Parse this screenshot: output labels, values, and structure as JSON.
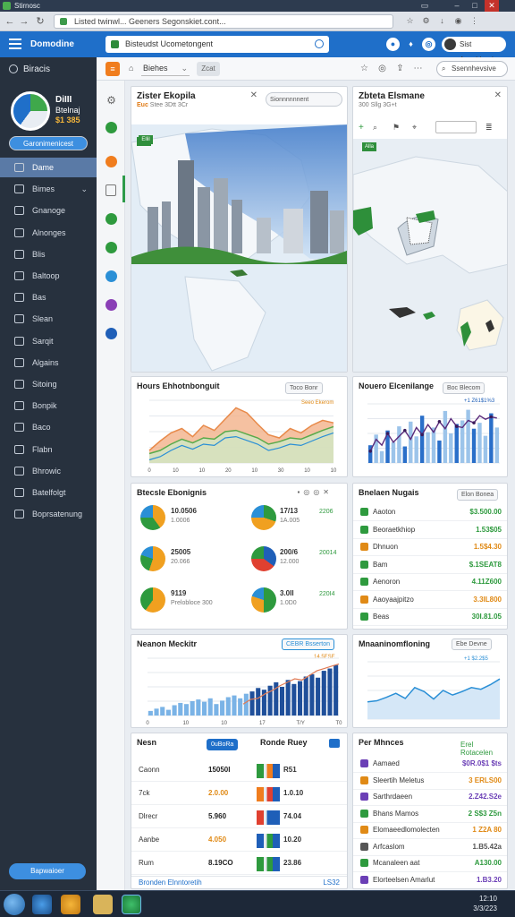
{
  "window": {
    "title": "Stirnosc"
  },
  "browser": {
    "url": "Listed twinwl... Geeners Segonskiet.cont..."
  },
  "header": {
    "brand": "Domodine",
    "search_text": "Bisteudst Ucometongent",
    "user": "Sist Aacabbeel"
  },
  "sidebar": {
    "head": "Biracis",
    "profile": {
      "name": "DiIII",
      "role": "Btelnaj",
      "number": "$1 385"
    },
    "profile_button": "Garonimenicest",
    "items": [
      {
        "label": "Dame",
        "active": true
      },
      {
        "label": "Bimes",
        "chevron": true
      },
      {
        "label": "Gnanoge"
      },
      {
        "label": "Alnonges"
      },
      {
        "label": "Blis"
      },
      {
        "label": "Baltoop"
      },
      {
        "label": "Bas"
      },
      {
        "label": "Slean"
      },
      {
        "label": "Sarqit"
      },
      {
        "label": "Algains"
      },
      {
        "label": "Sitoing"
      },
      {
        "label": "Bonpik"
      },
      {
        "label": "Baco"
      },
      {
        "label": "Flabn"
      },
      {
        "label": "Bhrowic"
      },
      {
        "label": "Batelfolgt"
      },
      {
        "label": "Boprsatenung"
      }
    ],
    "bottom_button": "Bapwaioer"
  },
  "subbar": {
    "select": "Biehes",
    "grey_button": "Zcat",
    "search_label": "Ssennhevsive"
  },
  "panels": {
    "map1": {
      "title": "Zister Ekopila",
      "subtitle_hl": "Euc",
      "subtitle": "Stee 3Dtt 3Cr",
      "button": "Sionnnnnnent",
      "tag": "Ellil"
    },
    "map2": {
      "title": "Zbteta Elsmane",
      "subtitle": "300 Sllg 3G+t",
      "tag": "Alla"
    },
    "area": {
      "title": "Hours Ehhotnbonguit",
      "button": "Toco Bonr",
      "legend": "Seeo Ekerom"
    },
    "barline": {
      "title": "Nouero Elcenilange",
      "button": "Boc Blecom",
      "annotation": "+1 Z61$1%3"
    },
    "pies": {
      "title": "Btecsle Ebonignis",
      "rows": [
        {
          "a": "10.0506",
          "b": "1.0006",
          "c": "17/13",
          "d": "1A.005",
          "e": "2206"
        },
        {
          "a": "25005",
          "b": "20.066",
          "c": "200/6",
          "d": "12.000",
          "e": "20014"
        },
        {
          "a": "9119",
          "b": "Prelobloce 300",
          "c": "3.0II",
          "d": "1.0D0",
          "e": "220I4"
        }
      ]
    },
    "list1": {
      "title": "Bnelaen Nugais",
      "button": "Elon Bonea",
      "rows": [
        {
          "name": "Aaoton",
          "value": "$3.500.00",
          "color": "#2e9a3e"
        },
        {
          "name": "Beoraetkhiop",
          "value": "1.53$05",
          "color": "#2e9a3e"
        },
        {
          "name": "Dhnuon",
          "value": "1.5$4.30",
          "color": "#e08a16"
        },
        {
          "name": "Bam",
          "value": "$.1SEAT8",
          "color": "#2e9a3e"
        },
        {
          "name": "Aenoron",
          "value": "4.11Z600",
          "color": "#2e9a3e"
        },
        {
          "name": "Aaoyaajpitzo",
          "value": "3.3IL800",
          "color": "#e08a16"
        },
        {
          "name": "Beas",
          "value": "30I.81.05",
          "color": "#2e9a3e"
        }
      ]
    },
    "bars": {
      "title": "Neanon Meckitr",
      "button": "CEBR Bsserton",
      "annotation": "14.5ESE",
      "x_ticks": [
        "0",
        "10",
        "10",
        "17",
        "T/Y",
        "T0"
      ]
    },
    "line2": {
      "title": "Mnaaninomfloning",
      "button": "Ebe Devne",
      "annotation": "+1 $2.2$5"
    },
    "table1": {
      "title": "Nesn",
      "chip": "0uBoRa",
      "title2": "Ronde Ruey",
      "rows": [
        {
          "label": "Caonn",
          "v1": "15050I",
          "v2": "R51"
        },
        {
          "label": "7ck",
          "v1": "2.0.00",
          "v2": "1.0.10"
        },
        {
          "label": "Dlrecr",
          "v1": "5.960",
          "v2": "74.04"
        },
        {
          "label": "Aanbe",
          "v1": "4.050",
          "v2": "10.20"
        },
        {
          "label": "Rum",
          "v1": "8.19CO",
          "v2": "23.86"
        }
      ],
      "footer": "Bronden Elnntoretih",
      "footer_right": "LS32"
    },
    "list2": {
      "title": "Per Mhnces",
      "button": "Erel Rotacelen",
      "rows": [
        {
          "name": "Aamaed",
          "value": "$0R.0$1 $ts",
          "color": "#6b3fb6"
        },
        {
          "name": "Sleertih Meletus",
          "value": "3 ERLS00",
          "color": "#e08a16"
        },
        {
          "name": "Sarthrdaeen",
          "value": "2.Z42.S2e",
          "color": "#6b3fb6"
        },
        {
          "name": "Bhans Mamos",
          "value": "2 S$3 Z5n",
          "color": "#2e9a3e"
        },
        {
          "name": "Elomaeedlomolecten",
          "value": "1 Z2A 80",
          "color": "#e08a16"
        },
        {
          "name": "Arfcaslom",
          "value": "1.B5.42a",
          "color": "#555555"
        },
        {
          "name": "Mcanaleen aat",
          "value": "A130.00",
          "color": "#2e9a3e"
        },
        {
          "name": "Elorteelsen Amarlut",
          "value": "1.B3.20",
          "color": "#6b3fb6"
        }
      ]
    }
  },
  "taskbar": {
    "time": "12:10",
    "date": "3/3/223"
  },
  "chart_data": [
    {
      "type": "area",
      "series": [
        {
          "values": [
            20,
            35,
            48,
            55,
            42,
            60,
            52,
            70,
            88,
            80,
            62,
            45,
            40,
            55,
            48,
            60,
            68,
            64
          ]
        },
        {
          "values": [
            15,
            20,
            30,
            38,
            32,
            40,
            38,
            50,
            52,
            46,
            40,
            30,
            34,
            40,
            38,
            45,
            52,
            58
          ]
        }
      ],
      "ylim": [
        0,
        100
      ]
    },
    {
      "type": "bar",
      "values": [
        30,
        48,
        20,
        55,
        35,
        62,
        28,
        70,
        45,
        80,
        52,
        60,
        38,
        88,
        50,
        66,
        72,
        90,
        58,
        68,
        46,
        84,
        60
      ],
      "line": [
        20,
        40,
        30,
        50,
        35,
        45,
        55,
        40,
        60,
        48,
        65,
        52,
        70,
        58,
        75,
        62,
        60,
        72,
        68,
        80,
        74,
        78,
        76
      ],
      "ylim": [
        0,
        100
      ]
    },
    {
      "type": "bar",
      "values": [
        8,
        12,
        15,
        10,
        18,
        22,
        20,
        25,
        28,
        24,
        30,
        20,
        26,
        32,
        35,
        30,
        38,
        42,
        48,
        45,
        52,
        58,
        50,
        62,
        55,
        60,
        68,
        72,
        66,
        78,
        82,
        88
      ],
      "line": [
        20,
        28,
        30,
        38,
        44,
        52,
        58,
        64,
        62,
        70,
        78,
        82,
        86,
        90
      ],
      "ylim": [
        0,
        100
      ]
    },
    {
      "type": "line",
      "values": [
        30,
        32,
        38,
        45,
        36,
        55,
        48,
        35,
        50,
        42,
        48,
        55,
        52,
        60,
        70
      ],
      "ylim": [
        0,
        100
      ]
    },
    {
      "type": "pie",
      "slices": [
        [
          40,
          35,
          25
        ],
        [
          30,
          45,
          25
        ],
        [
          55,
          25,
          20
        ],
        [
          35,
          40,
          25
        ],
        [
          60,
          40
        ],
        [
          50,
          30,
          20
        ]
      ]
    }
  ]
}
